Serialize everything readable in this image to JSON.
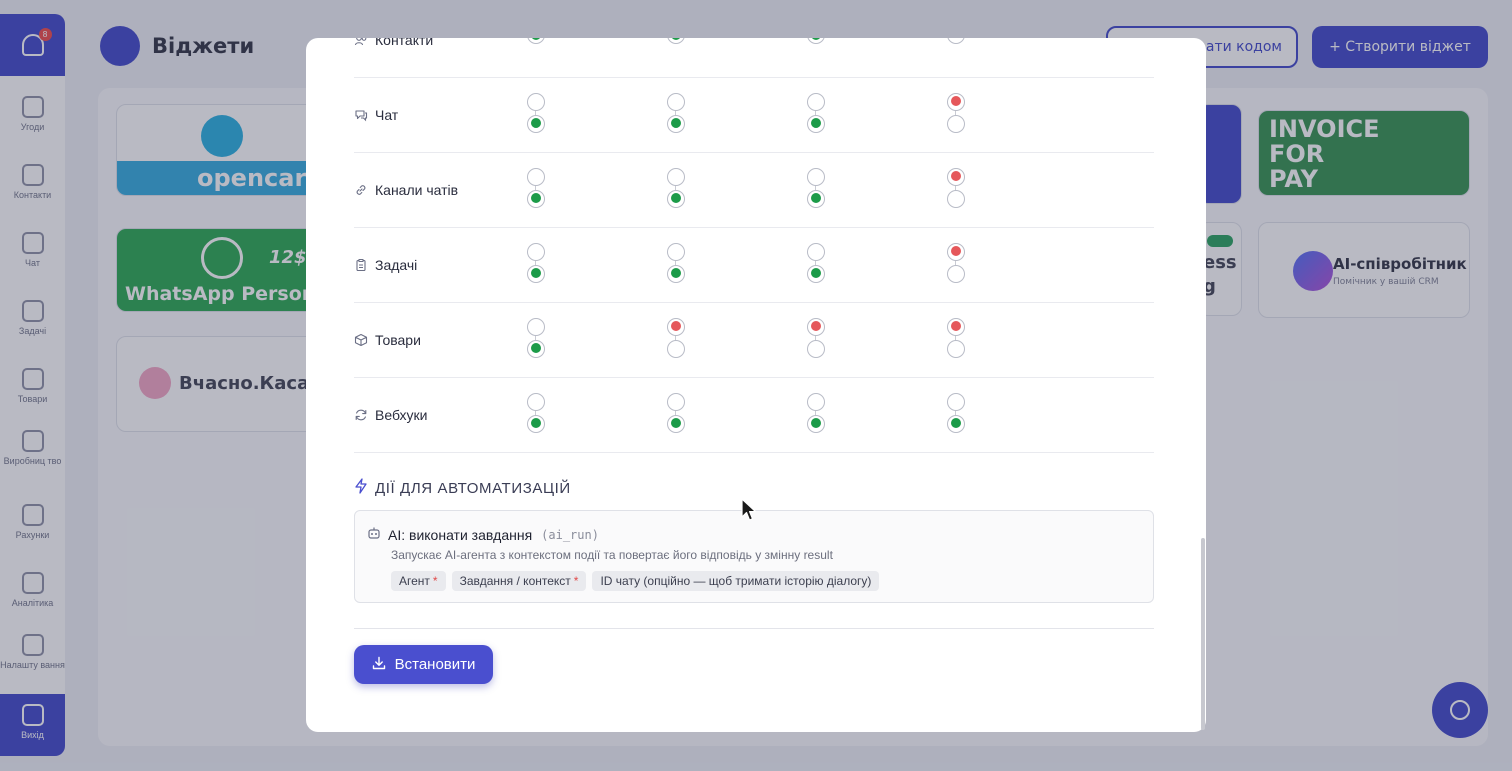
{
  "app": {
    "title": "Віджети",
    "notification_count": "8",
    "sidebar": [
      {
        "label": "Угоди",
        "icon": "deals-icon"
      },
      {
        "label": "Контакти",
        "icon": "contacts-icon"
      },
      {
        "label": "Чат",
        "icon": "chat-icon"
      },
      {
        "label": "Задачі",
        "icon": "tasks-icon"
      },
      {
        "label": "Товари",
        "icon": "products-icon"
      },
      {
        "label": "Виробниц тво",
        "icon": "production-icon"
      },
      {
        "label": "Рахунки",
        "icon": "invoices-icon"
      },
      {
        "label": "Аналітика",
        "icon": "analytics-icon"
      },
      {
        "label": "Налашту вання",
        "icon": "settings-icon"
      }
    ],
    "logout_label": "Вихід",
    "header_buttons": {
      "code": "...ати кодом",
      "create": "+ Створити віджет"
    },
    "widgets": {
      "opencart": "opencart",
      "whatsapp": "WhatsApp Persona",
      "whatsapp_price": "12$",
      "vchasno": "Вчасно.Каса",
      "invoice": [
        "INVOICE",
        "FOR",
        "PAY"
      ],
      "ess": [
        "ess",
        "g"
      ],
      "ai_name": "AI-співробітник",
      "ai_sub": "Помічник у вашій CRM"
    }
  },
  "modal": {
    "permissions": [
      {
        "label": "Контакти",
        "icon": "contacts-icon",
        "partial": true,
        "cols": [
          {
            "up": "off",
            "down": "green"
          },
          {
            "up": "off",
            "down": "green"
          },
          {
            "up": "off",
            "down": "green"
          },
          {
            "up": "off",
            "down": "off"
          }
        ]
      },
      {
        "label": "Чат",
        "icon": "chat-icon",
        "cols": [
          {
            "up": "off",
            "down": "green"
          },
          {
            "up": "off",
            "down": "green"
          },
          {
            "up": "off",
            "down": "green"
          },
          {
            "up": "red",
            "down": "off"
          }
        ]
      },
      {
        "label": "Канали чатів",
        "icon": "link-icon",
        "cols": [
          {
            "up": "off",
            "down": "green"
          },
          {
            "up": "off",
            "down": "green"
          },
          {
            "up": "off",
            "down": "green"
          },
          {
            "up": "red",
            "down": "off"
          }
        ]
      },
      {
        "label": "Задачі",
        "icon": "tasks-icon",
        "cols": [
          {
            "up": "off",
            "down": "green"
          },
          {
            "up": "off",
            "down": "green"
          },
          {
            "up": "off",
            "down": "green"
          },
          {
            "up": "red",
            "down": "off"
          }
        ]
      },
      {
        "label": "Товари",
        "icon": "box-icon",
        "cols": [
          {
            "up": "off",
            "down": "green"
          },
          {
            "up": "red",
            "down": "off"
          },
          {
            "up": "red",
            "down": "off"
          },
          {
            "up": "red",
            "down": "off"
          }
        ]
      },
      {
        "label": "Вебхуки",
        "icon": "refresh-icon",
        "cols": [
          {
            "up": "off",
            "down": "green"
          },
          {
            "up": "off",
            "down": "green"
          },
          {
            "up": "off",
            "down": "green"
          },
          {
            "up": "off",
            "down": "green"
          }
        ]
      }
    ],
    "automation_section_title": "ДІЇ ДЛЯ АВТОМАТИЗАЦІЙ",
    "action": {
      "name": "AI: виконати завдання",
      "code": "(ai_run)",
      "description": "Запускає AI-агента з контекстом події та повертає його відповідь у змінну result",
      "params": [
        {
          "label": "Агент",
          "required": "*"
        },
        {
          "label": "Завдання / контекст",
          "required": "*"
        },
        {
          "label": "ID чату (опційно — щоб тримати історію діалогу)",
          "required": ""
        }
      ]
    },
    "install_button": "Встановити"
  },
  "colors": {
    "accent": "#4a4fcf",
    "allowed": "#1c9b48",
    "denied": "#e5575a"
  }
}
